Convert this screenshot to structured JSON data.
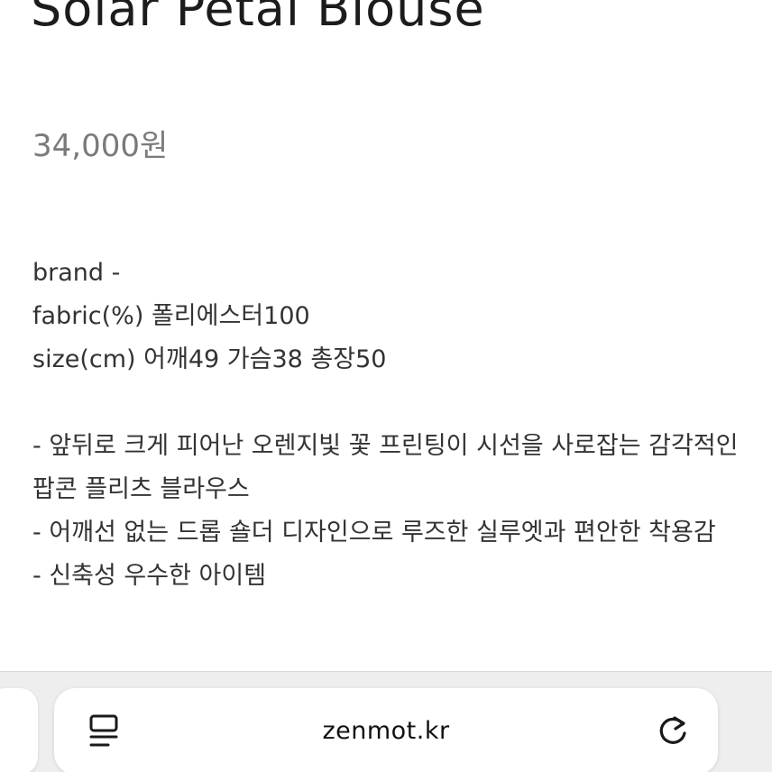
{
  "product": {
    "title": "Solar Petal Blouse",
    "price": "34,000원"
  },
  "details": {
    "brand": "brand -",
    "fabric": "fabric(%) 폴리에스터100",
    "size": "size(cm) 어깨49 가슴38 총장50",
    "description": [
      "- 앞뒤로 크게 피어난 오렌지빛 꽃 프린팅이 시선을 사로잡는 감각적인 팝콘 플리츠 블라우스",
      "- 어깨선 없는 드롭 숄더 디자인으로 루즈한 실루엣과 편안한 착용감",
      "- 신축성 우수한 아이템"
    ]
  },
  "browser": {
    "url": "zenmot.kr",
    "icons": {
      "reader": "reader-mode-icon",
      "reload": "reload-icon"
    }
  }
}
